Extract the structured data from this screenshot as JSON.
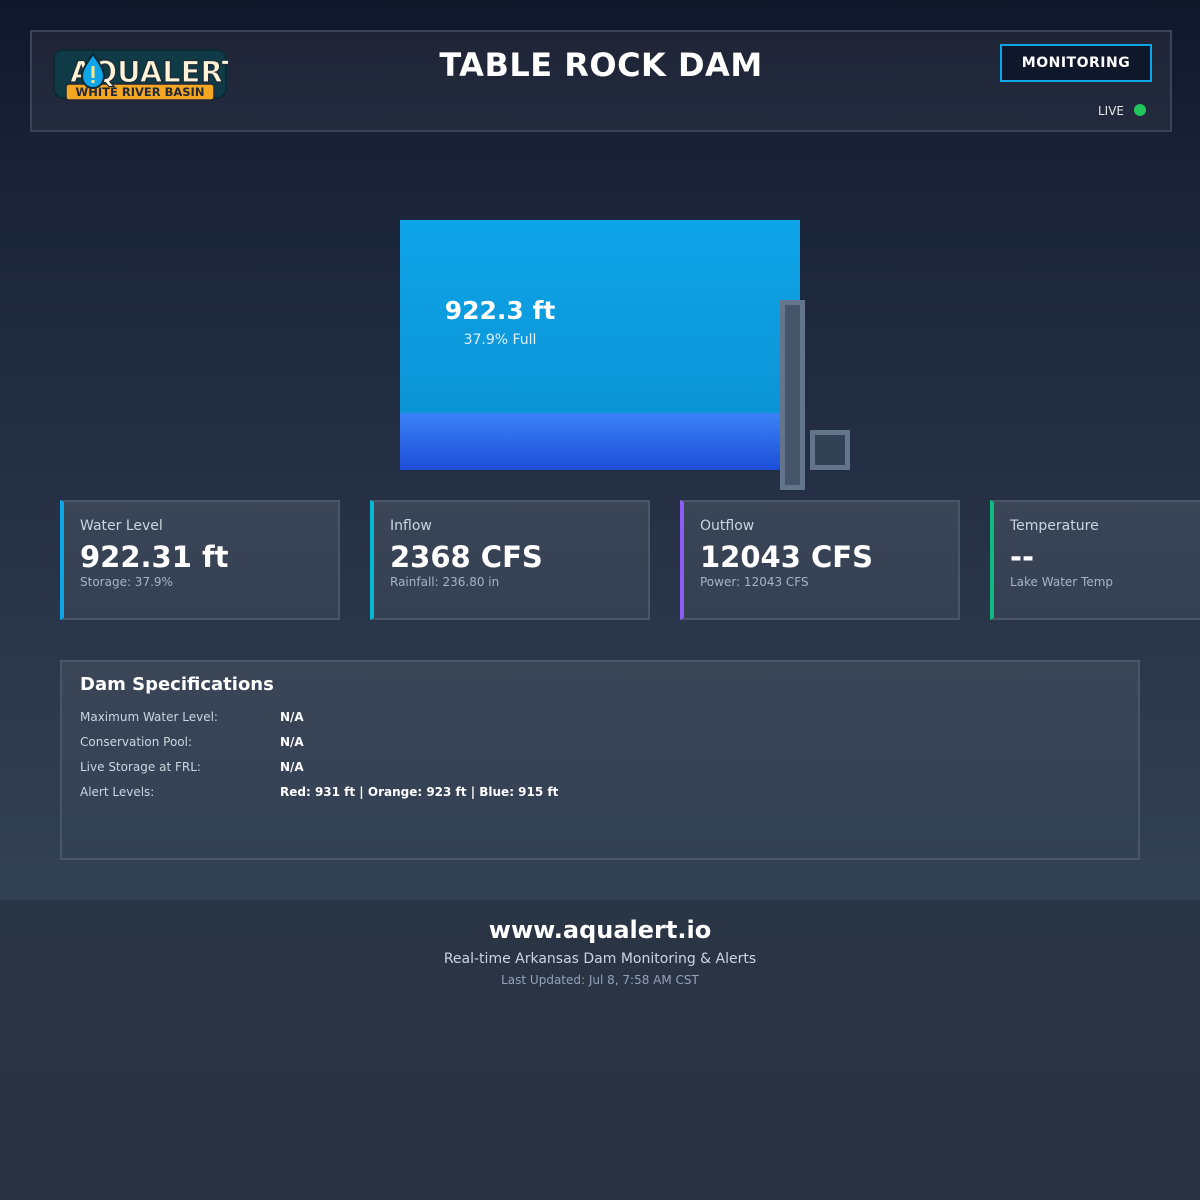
{
  "header": {
    "logo": {
      "wordmark": "AQUALERT",
      "subtitle": "WHITE RIVER BASIN",
      "icon": "water-drop-alert-icon"
    },
    "title": "TABLE ROCK DAM",
    "monitor_button": "MONITORING",
    "live_label": "LIVE",
    "live_color": "#22c55e"
  },
  "reservoir": {
    "level_text": "922.3 ft",
    "percent_text": "37.9% Full",
    "fill_fraction": 0.379,
    "water_color": "#0ea5e9",
    "band_color": "#2563eb"
  },
  "cards": [
    {
      "label": "Water Level",
      "value": "922.31 ft",
      "sub": "Storage: 37.9%",
      "accent": "#0ea5e9"
    },
    {
      "label": "Inflow",
      "value": "2368 CFS",
      "sub": "Rainfall: 236.80 in",
      "accent": "#06b6d4"
    },
    {
      "label": "Outflow",
      "value": "12043 CFS",
      "sub": "Power: 12043 CFS",
      "accent": "#8b5cf6"
    },
    {
      "label": "Temperature",
      "value": "--",
      "sub": "Lake Water Temp",
      "accent": "#10b981"
    }
  ],
  "specs": {
    "title": "Dam Specifications",
    "rows": [
      {
        "key": "Maximum Water Level:",
        "value": "N/A"
      },
      {
        "key": "Conservation Pool:",
        "value": "N/A"
      },
      {
        "key": "Live Storage at FRL:",
        "value": "N/A"
      },
      {
        "key": "Alert Levels:",
        "value": "Red: 931 ft | Orange: 923 ft | Blue: 915 ft"
      }
    ]
  },
  "footer": {
    "site": "www.aqualert.io",
    "tagline": "Real-time Arkansas Dam Monitoring & Alerts",
    "updated": "Last Updated: Jul 8, 7:58 AM CST"
  }
}
